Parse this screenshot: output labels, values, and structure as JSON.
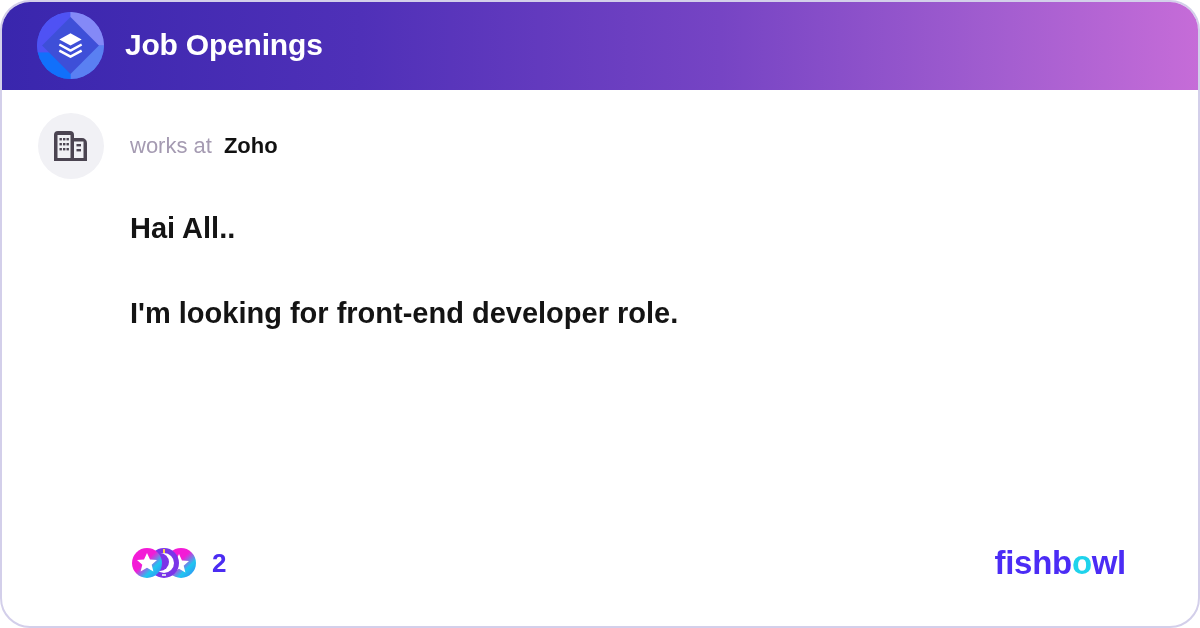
{
  "header": {
    "title": "Job Openings"
  },
  "author": {
    "label": "works at",
    "company": "Zoho"
  },
  "post": {
    "paragraphs": [
      "Hai All..",
      "I'm looking for front-end developer role."
    ]
  },
  "footer": {
    "reactions": {
      "count": "2"
    },
    "logo": {
      "segments": [
        {
          "text": "fishb",
          "accent": false
        },
        {
          "text": "o",
          "accent": true
        },
        {
          "text": "wl",
          "accent": false
        }
      ]
    }
  }
}
